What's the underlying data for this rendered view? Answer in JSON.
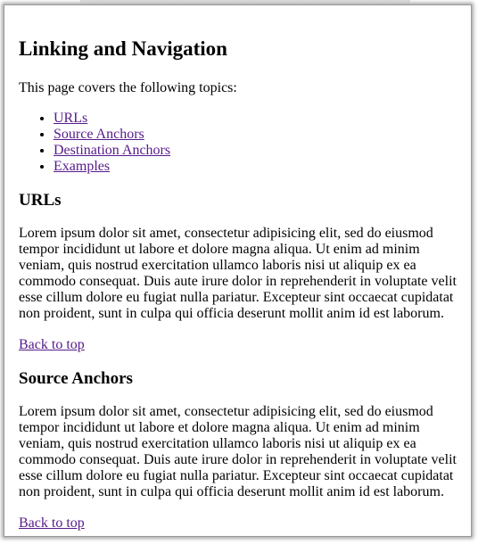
{
  "page": {
    "title": "Linking and Navigation",
    "intro": "This page covers the following topics:",
    "toc": [
      {
        "label": "URLs"
      },
      {
        "label": "Source Anchors"
      },
      {
        "label": "Destination Anchors"
      },
      {
        "label": "Examples"
      }
    ],
    "sections": [
      {
        "heading": "URLs",
        "body": "Lorem ipsum dolor sit amet, consectetur adipisicing elit, sed do eiusmod tempor incididunt ut labore et dolore magna aliqua. Ut enim ad minim veniam, quis nostrud exercitation ullamco laboris nisi ut aliquip ex ea commodo consequat. Duis aute irure dolor in reprehenderit in voluptate velit esse cillum dolore eu fugiat nulla pariatur. Excepteur sint occaecat cupidatat non proident, sunt in culpa qui officia deserunt mollit anim id est laborum.",
        "back_to_top": "Back to top"
      },
      {
        "heading": "Source Anchors",
        "body": "Lorem ipsum dolor sit amet, consectetur adipisicing elit, sed do eiusmod tempor incididunt ut labore et dolore magna aliqua. Ut enim ad minim veniam, quis nostrud exercitation ullamco laboris nisi ut aliquip ex ea commodo consequat. Duis aute irure dolor in reprehenderit in voluptate velit esse cillum dolore eu fugiat nulla pariatur. Excepteur sint occaecat cupidatat non proident, sunt in culpa qui officia deserunt mollit anim id est laborum.",
        "back_to_top": "Back to top"
      }
    ]
  },
  "colors": {
    "link_visited": "#551a8b",
    "text": "#000000",
    "background": "#ffffff"
  }
}
